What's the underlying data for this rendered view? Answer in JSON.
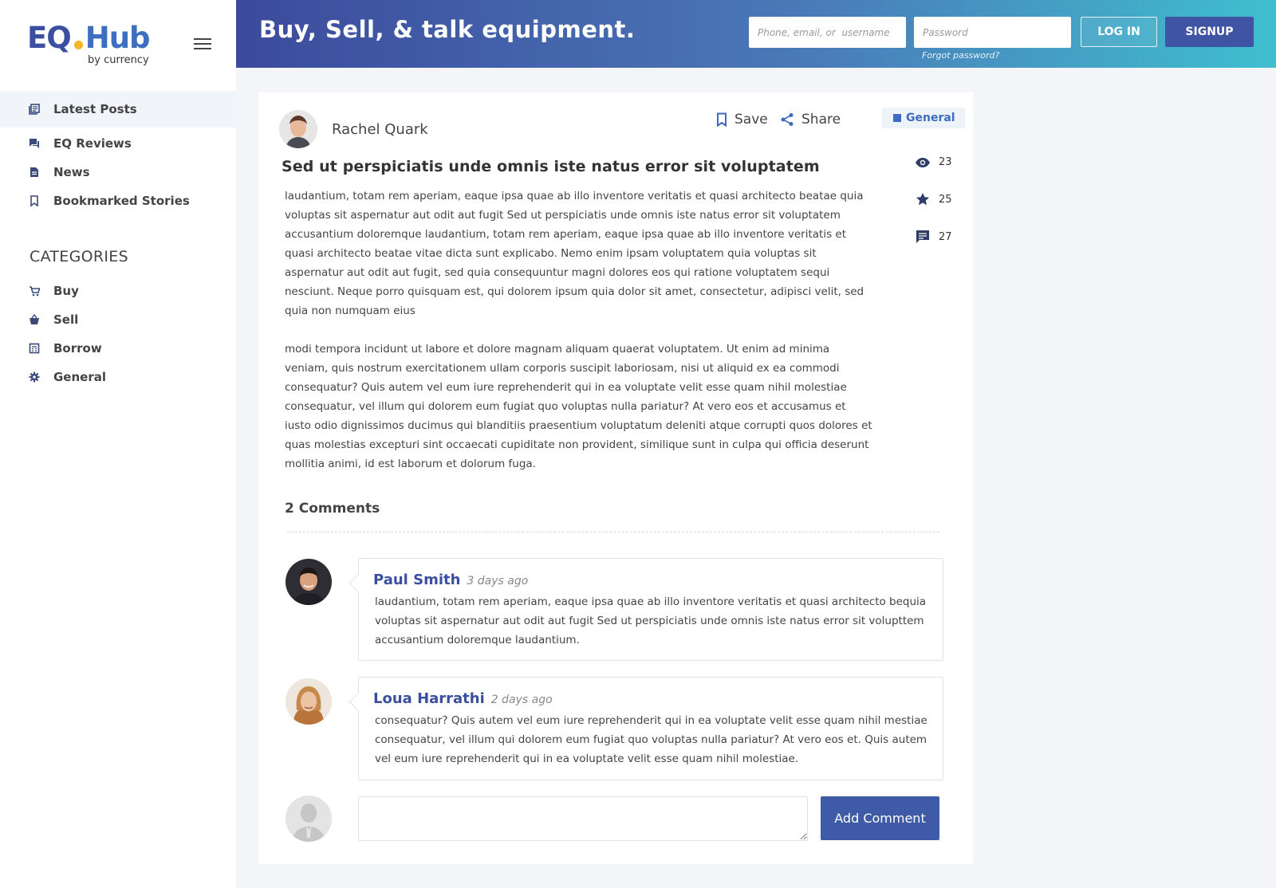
{
  "brand": {
    "logo_left": "EQ",
    "logo_right": "Hub",
    "logo_sub": "by currency",
    "accent": "#3f55a3",
    "dot_color": "#f5b526"
  },
  "sidebar": {
    "items": [
      {
        "label": "Latest Posts",
        "icon": "newspaper-icon"
      },
      {
        "label": "EQ Reviews",
        "icon": "chat-icon"
      },
      {
        "label": "News",
        "icon": "document-icon"
      },
      {
        "label": "Bookmarked Stories",
        "icon": "bookmark-icon"
      }
    ],
    "categories_title": "CATEGORIES",
    "categories": [
      {
        "label": "Buy",
        "icon": "cart-icon"
      },
      {
        "label": "Sell",
        "icon": "basket-icon"
      },
      {
        "label": "Borrow",
        "icon": "calculator-icon"
      },
      {
        "label": "General",
        "icon": "gear-icon"
      }
    ]
  },
  "header": {
    "tagline": "Buy, Sell, & talk equipment.",
    "username_placeholder": "Phone, email, or  username",
    "password_placeholder": "Password",
    "login_label": "LOG IN",
    "signup_label": "SIGNUP",
    "forgot_label": "Forgot password?"
  },
  "post": {
    "author": "Rachel Quark",
    "save_label": "Save",
    "share_label": "Share",
    "tag": "General",
    "title": "Sed ut perspiciatis unde omnis iste natus error sit voluptatem",
    "stats": {
      "views": "23",
      "stars": "25",
      "comments": "27"
    },
    "paragraphs": [
      "laudantium, totam rem aperiam, eaque ipsa quae ab illo inventore veritatis et quasi architecto beatae quia voluptas sit aspernatur aut odit aut fugit Sed ut perspiciatis unde omnis iste natus error sit voluptatem accusantium doloremque laudantium, totam rem aperiam, eaque ipsa quae ab illo inventore veritatis et quasi architecto beatae vitae dicta sunt explicabo. Nemo enim ipsam voluptatem quia voluptas sit aspernatur aut odit aut fugit, sed quia consequuntur magni dolores eos qui ratione voluptatem sequi nesciunt. Neque porro quisquam est, qui dolorem ipsum quia dolor sit amet, consectetur, adipisci velit, sed quia non numquam eius",
      "modi tempora incidunt ut labore et dolore magnam aliquam quaerat voluptatem. Ut enim ad minima veniam, quis nostrum exercitationem ullam corporis suscipit laboriosam, nisi ut aliquid ex ea commodi consequatur? Quis autem vel eum iure reprehenderit qui in ea voluptate velit esse quam nihil molestiae consequatur, vel illum qui dolorem eum fugiat quo voluptas nulla pariatur? At vero eos et accusamus et iusto odio dignissimos ducimus qui blanditiis praesentium voluptatum deleniti atque corrupti quos dolores et quas molestias excepturi sint occaecati cupiditate non provident, similique sunt in culpa qui officia deserunt mollitia animi, id est laborum et dolorum fuga."
    ]
  },
  "comments": {
    "title": "2 Comments",
    "items": [
      {
        "name": "Paul Smith",
        "time": "3 days ago",
        "text": "laudantium, totam rem aperiam, eaque ipsa quae ab illo inventore veritatis et quasi architecto bequia voluptas sit aspernatur aut odit aut fugit Sed ut perspiciatis unde omnis iste natus error sit volupttem accusantium doloremque laudantium."
      },
      {
        "name": "Loua Harrathi",
        "time": "2 days ago",
        "text": "consequatur? Quis autem vel eum iure reprehenderit qui in ea voluptate velit esse quam nihil mestiae consequatur, vel illum qui dolorem eum fugiat quo voluptas nulla pariatur? At vero eos et. Quis autem vel eum iure reprehenderit qui in ea voluptate velit esse quam nihil molestiae."
      }
    ],
    "add_label": "Add Comment"
  }
}
